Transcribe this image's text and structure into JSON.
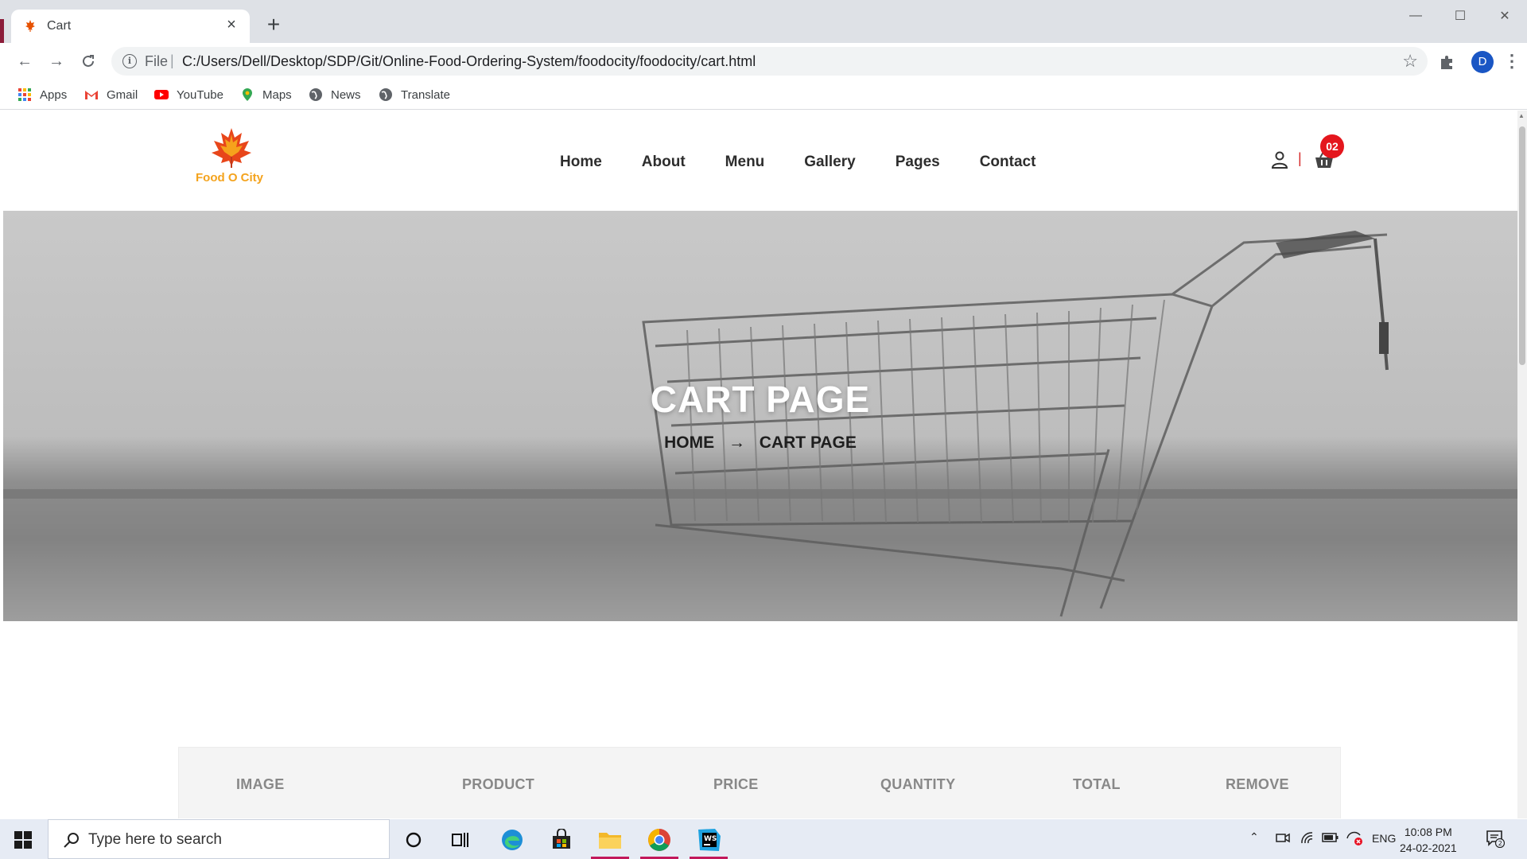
{
  "browser": {
    "tab_title": "Cart",
    "url_scheme": "File",
    "url": "C:/Users/Dell/Desktop/SDP/Git/Online-Food-Ordering-System/foodocity/foodocity/cart.html",
    "profile_initial": "D",
    "bookmarks": [
      "Apps",
      "Gmail",
      "YouTube",
      "Maps",
      "News",
      "Translate"
    ]
  },
  "site": {
    "logo_text": "Food O City",
    "nav": [
      "Home",
      "About",
      "Menu",
      "Gallery",
      "Pages",
      "Contact"
    ],
    "cart_count": "02",
    "header_separator": "|"
  },
  "hero": {
    "title": "CART PAGE",
    "breadcrumb_home": "HOME",
    "breadcrumb_arrow": "→",
    "breadcrumb_current": "CART PAGE"
  },
  "cart_table": {
    "columns": [
      "IMAGE",
      "PRODUCT",
      "PRICE",
      "QUANTITY",
      "TOTAL",
      "REMOVE"
    ]
  },
  "taskbar": {
    "search_placeholder": "Type here to search",
    "language": "ENG",
    "time": "10:08 PM",
    "date": "24-02-2021",
    "notification_count": "2"
  },
  "colors": {
    "brand_orange": "#f4a31d",
    "cart_badge": "#e4161d",
    "taskbar_active": "#c2185b"
  }
}
